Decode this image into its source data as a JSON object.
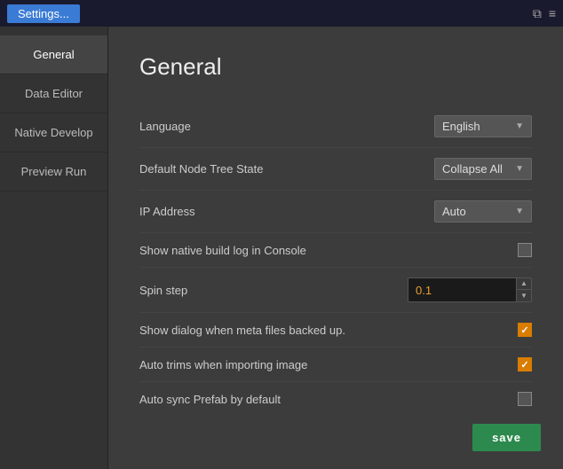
{
  "titlebar": {
    "title": "Settings...",
    "icon_window": "⧉",
    "icon_menu": "≡"
  },
  "sidebar": {
    "items": [
      {
        "id": "general",
        "label": "General",
        "active": true
      },
      {
        "id": "data-editor",
        "label": "Data Editor",
        "active": false
      },
      {
        "id": "native-develop",
        "label": "Native Develop",
        "active": false
      },
      {
        "id": "preview-run",
        "label": "Preview Run",
        "active": false
      }
    ]
  },
  "content": {
    "title": "General",
    "settings": [
      {
        "id": "language",
        "label": "Language",
        "type": "dropdown",
        "value": "English",
        "arrow": "▼"
      },
      {
        "id": "default-node-tree-state",
        "label": "Default Node Tree State",
        "type": "dropdown",
        "value": "Collapse All",
        "arrow": "▼"
      },
      {
        "id": "ip-address",
        "label": "IP Address",
        "type": "dropdown",
        "value": "Auto",
        "arrow": "▼"
      },
      {
        "id": "show-native-build-log",
        "label": "Show native build log in Console",
        "type": "checkbox",
        "checked": false
      },
      {
        "id": "spin-step",
        "label": "Spin step",
        "type": "number",
        "value": "0.1"
      },
      {
        "id": "show-dialog-meta",
        "label": "Show dialog when meta files backed up.",
        "type": "checkbox",
        "checked": true
      },
      {
        "id": "auto-trims",
        "label": "Auto trims when importing image",
        "type": "checkbox",
        "checked": true
      },
      {
        "id": "auto-sync-prefab",
        "label": "Auto sync Prefab by default",
        "type": "checkbox",
        "checked": false
      }
    ],
    "save_button_label": "save"
  }
}
